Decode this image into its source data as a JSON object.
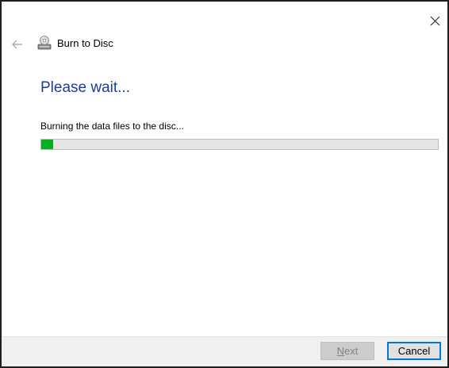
{
  "window": {
    "close_icon": "close-icon"
  },
  "header": {
    "back_icon": "back-arrow-icon",
    "app_icon": "disc-burner-icon",
    "title": "Burn to Disc"
  },
  "main": {
    "heading": "Please wait...",
    "status_text": "Burning the data files to the disc...",
    "progress": {
      "percent": 3,
      "fill_color": "#06b025",
      "track_color": "#e6e6e6"
    },
    "heading_color": "#1e3c9a"
  },
  "footer": {
    "next_mnemonic": "N",
    "next_rest": "ext",
    "next_enabled": false,
    "cancel_label": "Cancel",
    "cancel_focus_color": "#0078d7"
  }
}
